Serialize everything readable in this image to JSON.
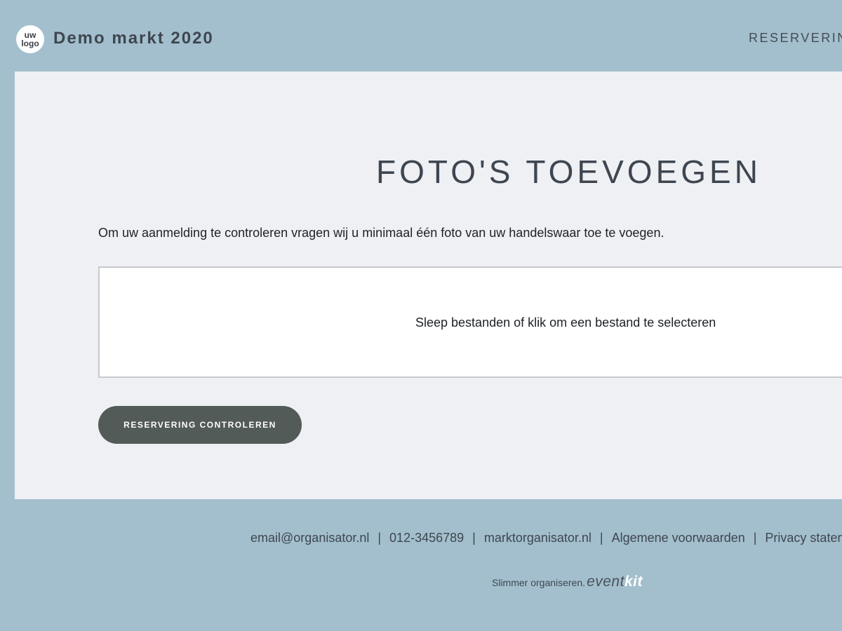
{
  "header": {
    "logo_line1": "uw",
    "logo_line2": "logo",
    "site_title": "Demo markt 2020",
    "nav_reservering": "RESERVERING"
  },
  "main": {
    "title": "FOTO'S TOEVOEGEN",
    "intro": "Om uw aanmelding te controleren vragen wij u minimaal één foto van uw handelswaar toe te voegen.",
    "dropzone_text": "Sleep bestanden of klik om een bestand te selecteren",
    "button_label": "RESERVERING CONTROLEREN"
  },
  "footer": {
    "email": "email@organisator.nl",
    "phone": "012-3456789",
    "website": "marktorganisator.nl",
    "terms": "Algemene voorwaarden",
    "privacy": "Privacy statement",
    "separator": "|",
    "tagline": "Slimmer organiseren.",
    "brand_part1": "event",
    "brand_part2": "kit"
  },
  "colors": {
    "background": "#a3bfcd",
    "card": "#eff0f4",
    "button": "#535b59",
    "text_dark": "#3e4650"
  }
}
